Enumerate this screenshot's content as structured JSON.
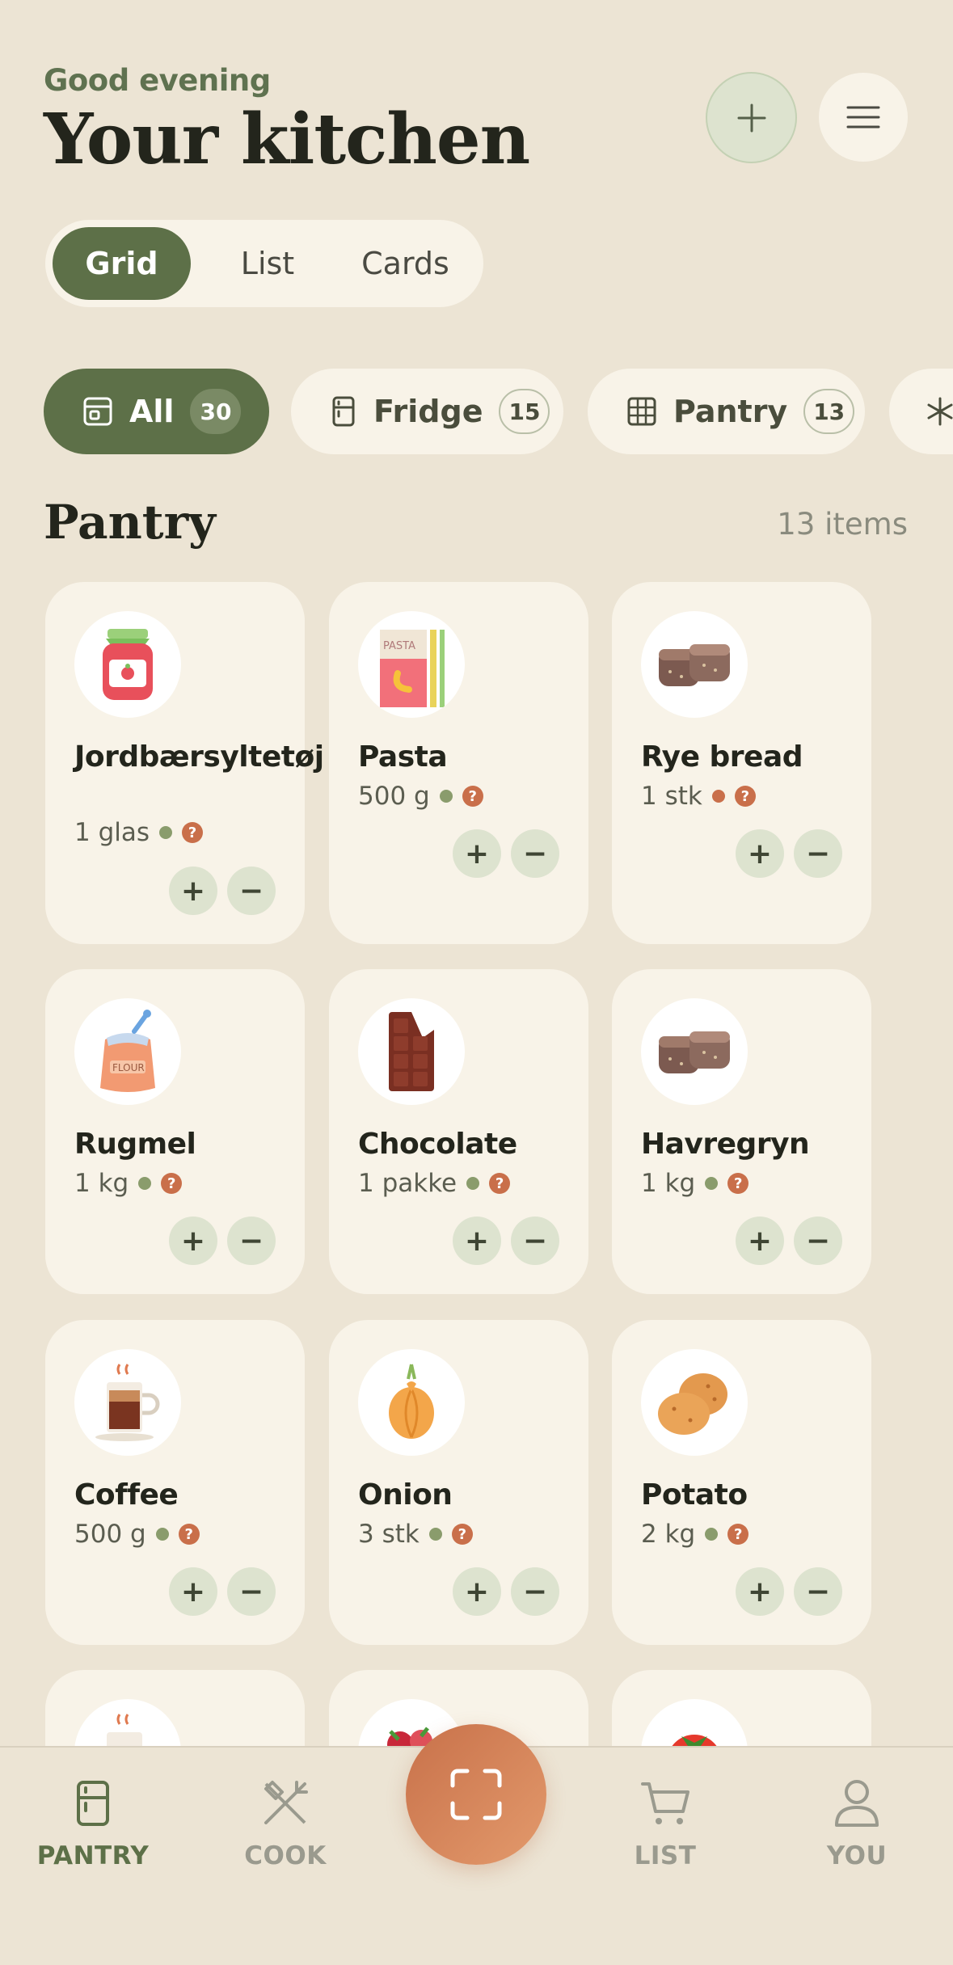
{
  "header": {
    "greeting": "Good evening",
    "title": "Your kitchen",
    "add_icon": "plus-icon",
    "menu_icon": "hamburger-menu-icon"
  },
  "view_modes": [
    {
      "label": "Grid",
      "active": true
    },
    {
      "label": "List",
      "active": false
    },
    {
      "label": "Cards",
      "active": false
    }
  ],
  "filters": [
    {
      "label": "All",
      "count": "30",
      "icon": "all-items-icon",
      "active": true
    },
    {
      "label": "Fridge",
      "count": "15",
      "icon": "fridge-icon",
      "active": false
    },
    {
      "label": "Pantry",
      "count": "13",
      "icon": "pantry-grid-icon",
      "active": false
    },
    {
      "label": "",
      "count": "",
      "icon": "freezer-snowflake-icon",
      "active": false
    }
  ],
  "section": {
    "title": "Pantry",
    "count_text": "13 items"
  },
  "items": [
    {
      "name": "Jordbærsyltetøj",
      "quantity": "1 glas",
      "status": "ok",
      "icon": "jam-jar-icon"
    },
    {
      "name": "Pasta",
      "quantity": "500 g",
      "status": "ok",
      "icon": "pasta-box-icon"
    },
    {
      "name": "Rye bread",
      "quantity": "1 stk",
      "status": "warn",
      "icon": "bread-icon"
    },
    {
      "name": "Rugmel",
      "quantity": "1 kg",
      "status": "ok",
      "icon": "flour-sack-icon"
    },
    {
      "name": "Chocolate",
      "quantity": "1 pakke",
      "status": "ok",
      "icon": "chocolate-bar-icon"
    },
    {
      "name": "Havregryn",
      "quantity": "1 kg",
      "status": "ok",
      "icon": "bread-icon"
    },
    {
      "name": "Coffee",
      "quantity": "500 g",
      "status": "ok",
      "icon": "coffee-cup-icon"
    },
    {
      "name": "Onion",
      "quantity": "3 stk",
      "status": "ok",
      "icon": "onion-icon"
    },
    {
      "name": "Potato",
      "quantity": "2 kg",
      "status": "ok",
      "icon": "potato-icon"
    }
  ],
  "stepper": {
    "plus": "+",
    "minus": "−",
    "unknown": "?"
  },
  "bottom_nav": [
    {
      "label": "PANTRY",
      "icon": "fridge-icon",
      "active": true
    },
    {
      "label": "COOK",
      "icon": "fork-knife-icon",
      "active": false
    },
    {
      "label": "LIST",
      "icon": "cart-icon",
      "active": false
    },
    {
      "label": "YOU",
      "icon": "user-icon",
      "active": false
    }
  ],
  "scan_icon": "scan-frame-icon",
  "colors": {
    "background": "#ece4d4",
    "card": "#f8f3e8",
    "accent_green": "#5d7048",
    "soft_green": "#dde3cf",
    "accent_orange": "#c96f4a"
  }
}
